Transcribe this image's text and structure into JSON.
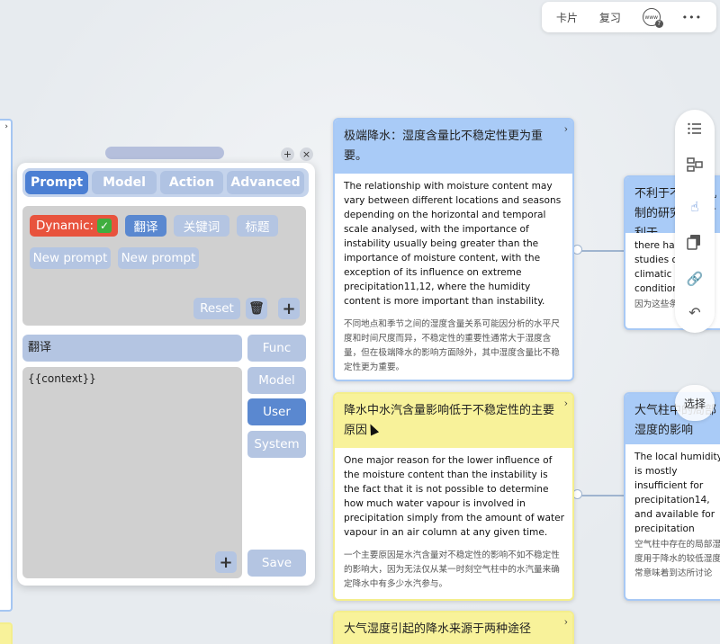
{
  "toolbar": {
    "cards_label": "卡片",
    "review_label": "复习",
    "www_icon": "www-help-icon",
    "more_label": "•••"
  },
  "colors": {
    "card_blue_header": "#a9cbf7",
    "card_yellow_header": "#f8f29a",
    "tab_active": "#4b7fd3",
    "dynamic_chip": "#e8533d"
  },
  "cards": [
    {
      "title": "极端降水：湿度含量比不稳定性更为重要。",
      "en": "The relationship with moisture content may vary between different locations and seasons depending on the horizontal and temporal scale analysed, with the importance of instability usually being greater than the importance of moisture content, with the exception of its influence on extreme precipitation11,12, where the humidity content is more important than instability.",
      "zh": "不同地点和季节之间的湿度含量关系可能因分析的水平尺度和时间尺度而异，不稳定性的重要性通常大于湿度含量，但在极端降水的影响方面除外，其中湿度含量比不稳定性更为重要。"
    },
    {
      "title": "降水中水汽含量影响低于不稳定性的主要原因",
      "en": "One major reason for the lower influence of the moisture content than the instability is the fact that it is not possible to determine how much water vapour is involved in precipitation simply from the amount of water vapour in an air column at any given time.",
      "zh": "一个主要原因是水汽含量对不稳定性的影响不如不稳定性的影响大，因为无法仅从某一时刻空气柱中的水汽量来确定降水中有多少水汽参与。"
    },
    {
      "title": "大气湿度引起的降水来源于两种途径"
    },
    {
      "title": "不利于不稳定机制的研究，但有利于",
      "en": "there have been studies on climatic conditions favourable for mechanisms and the occurrence of drought",
      "zh": "因为这些条件要素"
    },
    {
      "title": "大气柱中的局部湿度的影响",
      "en": "The local humidity is mostly insufficient for precipitation14, and available for precipitation generally imply a de reaches the site in",
      "zh": "空气柱中存在的局部湿度用于降水的较低湿度常意味着到达所讨论"
    }
  ],
  "right_toolbar": {
    "icons": [
      "list-icon",
      "layout-icon",
      "hand-pointer-icon",
      "copy-icon",
      "link-icon",
      "undo-icon"
    ],
    "select_label": "选择"
  },
  "panel": {
    "tabs": [
      "Prompt",
      "Model",
      "Action",
      "Advanced"
    ],
    "active_tab": "Prompt",
    "dynamic_label": "Dynamic:",
    "chips": [
      "翻译",
      "关键词",
      "标题"
    ],
    "new_prompts": [
      "New prompt",
      "New prompt"
    ],
    "reset_label": "Reset",
    "trash_icon": "trash-icon",
    "plus": "+",
    "prompt_name": "翻译",
    "prompt_body": "{{context}}",
    "side_buttons": [
      "Func",
      "Model",
      "User",
      "System"
    ],
    "active_side": "User",
    "save_label": "Save"
  }
}
